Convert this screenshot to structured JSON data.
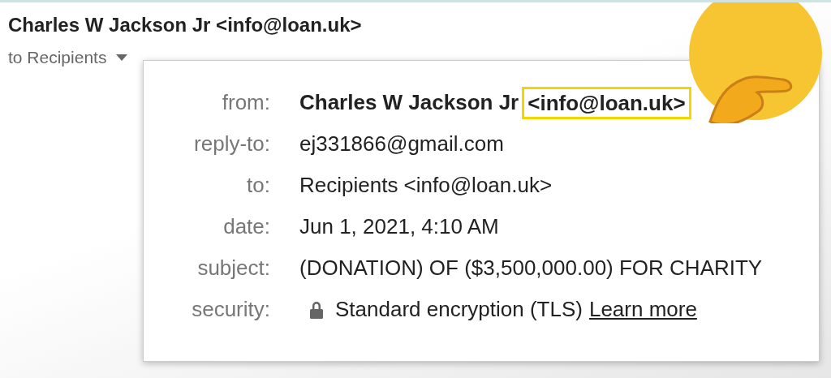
{
  "sender": {
    "name": "Charles W Jackson Jr <info@loan.uk>"
  },
  "recipients": {
    "label": "to Recipients",
    "expanded": true
  },
  "details": [
    {
      "kind": "from",
      "label": "from:",
      "name": "Charles W Jackson Jr",
      "email": "<info@loan.uk>",
      "highlighted": true
    },
    {
      "kind": "text",
      "label": "reply-to:",
      "value": "ej331866@gmail.com"
    },
    {
      "kind": "text",
      "label": "to:",
      "value": "Recipients <info@loan.uk>"
    },
    {
      "kind": "text",
      "label": "date:",
      "value": "Jun 1, 2021, 4:10 AM"
    },
    {
      "kind": "text",
      "label": "subject:",
      "value": "(DONATION) OF ($3,500,000.00) FOR CHARITY"
    },
    {
      "kind": "security",
      "label": "security:",
      "value": "Standard encryption (TLS)",
      "link": "Learn more"
    }
  ]
}
